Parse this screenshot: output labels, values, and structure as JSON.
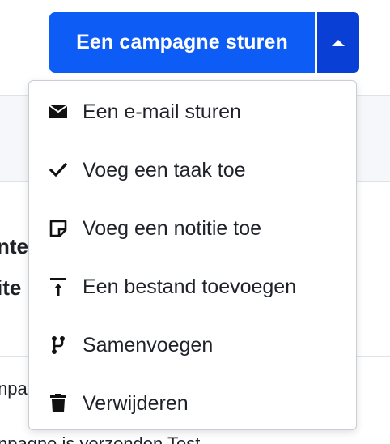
{
  "split_button": {
    "label": "Een campagne sturen",
    "toggle_icon": "caret-up-icon"
  },
  "menu": {
    "items": [
      {
        "label": "Een e-mail sturen",
        "icon": "envelope-icon"
      },
      {
        "label": "Voeg een taak toe",
        "icon": "checkmark-icon"
      },
      {
        "label": "Voeg een notitie toe",
        "icon": "note-icon"
      },
      {
        "label": "Een bestand toevoegen",
        "icon": "upload-icon"
      },
      {
        "label": "Samenvoegen",
        "icon": "merge-icon"
      },
      {
        "label": "Verwijderen",
        "icon": "trash-icon"
      }
    ]
  },
  "background": {
    "line1": "nte",
    "line2": "ite",
    "line3": "npa",
    "line4": "npagne is verzonden Test"
  },
  "colors": {
    "primary": "#0d5cf5",
    "primary_dark": "#0a3fd6",
    "text": "#1f2329",
    "border": "#c8ced6"
  }
}
